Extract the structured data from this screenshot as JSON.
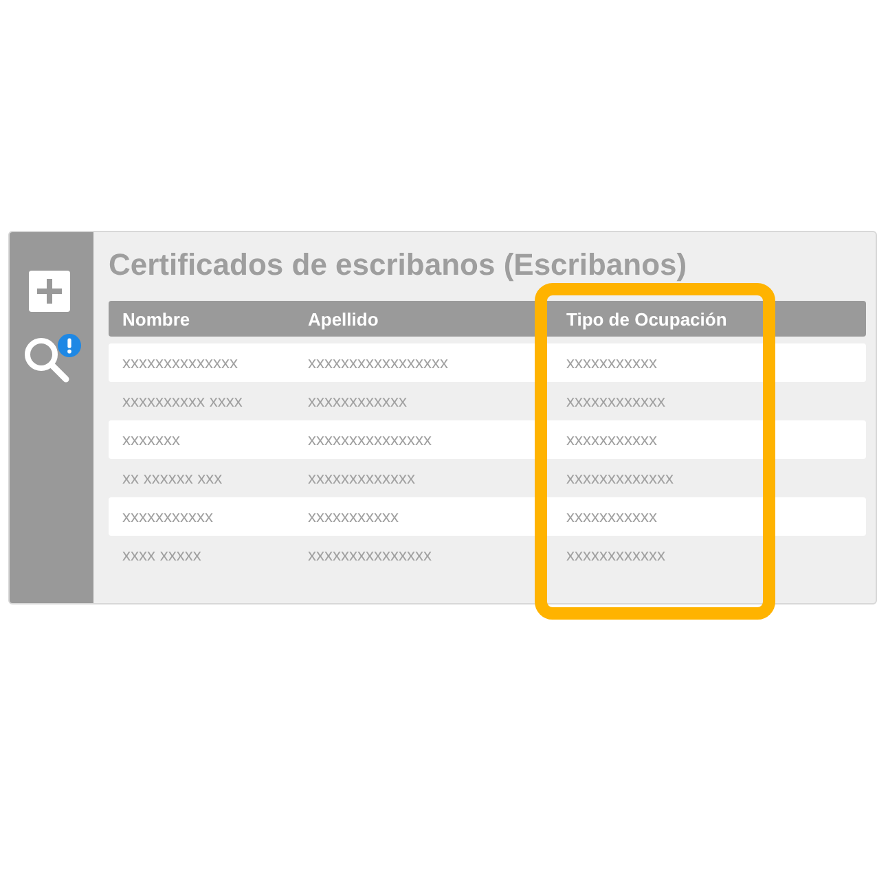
{
  "title": "Certificados de escribanos (Escribanos)",
  "table": {
    "columns": [
      "Nombre",
      "Apellido",
      "Tipo de Ocupación"
    ],
    "rows": [
      [
        "xxxxxxxxxxxxxx",
        "xxxxxxxxxxxxxxxxx",
        "xxxxxxxxxxx"
      ],
      [
        "xxxxxxxxxx xxxx",
        "xxxxxxxxxxxx",
        "xxxxxxxxxxxx"
      ],
      [
        "xxxxxxx",
        "xxxxxxxxxxxxxxx",
        "xxxxxxxxxxx"
      ],
      [
        "xx xxxxxx xxx",
        "xxxxxxxxxxxxx",
        "xxxxxxxxxxxxx"
      ],
      [
        "xxxxxxxxxxx",
        "xxxxxxxxxxx",
        "xxxxxxxxxxx"
      ],
      [
        "xxxx xxxxx",
        "xxxxxxxxxxxxxxx",
        "xxxxxxxxxxxx"
      ]
    ]
  }
}
